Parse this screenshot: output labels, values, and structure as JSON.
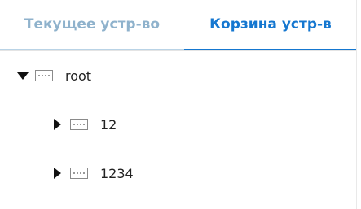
{
  "tabs": {
    "current_label": "Текущее устр-во",
    "trash_label": "Корзина устр-в",
    "active": "trash"
  },
  "tree": {
    "root": {
      "label": "root",
      "expanded": true,
      "icon": "device-icon",
      "children": [
        {
          "label": "12",
          "expanded": false,
          "icon": "device-icon"
        },
        {
          "label": "1234",
          "expanded": false,
          "icon": "device-icon"
        }
      ]
    }
  },
  "colors": {
    "active_tab": "#1577d0",
    "inactive_tab": "#8fb2cc",
    "inactive_tab_underline": "#b9d3e6"
  }
}
